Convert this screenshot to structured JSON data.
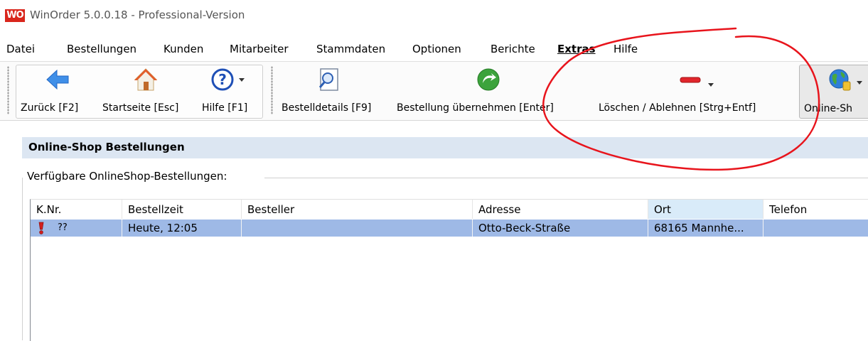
{
  "window": {
    "logo_text": "WO",
    "title": "WinOrder 5.0.0.18 - Professional-Version"
  },
  "menu": [
    "Datei",
    "Bestellungen",
    "Kunden",
    "Mitarbeiter",
    "Stammdaten",
    "Optionen",
    "Berichte",
    "Extras",
    "Hilfe"
  ],
  "toolbar": {
    "back": "Zurück [F2]",
    "home": "Startseite [Esc]",
    "help": "Hilfe [F1]",
    "details": "Bestelldetails [F9]",
    "accept": "Bestellung übernehmen [Enter]",
    "delete": "Löschen / Ablehnen [Strg+Entf]",
    "online_shop": "Online-Sh"
  },
  "section": {
    "title": "Online-Shop Bestellungen",
    "group_label": "Verfügbare OnlineShop-Bestellungen:"
  },
  "table": {
    "columns": [
      "K.Nr.",
      "Bestellzeit",
      "Besteller",
      "Adresse",
      "Ort",
      "Telefon"
    ],
    "rows": [
      {
        "knr": "??",
        "bestellzeit": "Heute, 12:05",
        "besteller": "",
        "adresse": "Otto-Beck-Straße",
        "ort": "68165 Mannhe...",
        "telefon": ""
      }
    ]
  },
  "colors": {
    "accent_header": "#dce6f2",
    "selected_row": "#9eb9e6",
    "annotation": "#e8141c"
  },
  "icons": [
    "app-logo",
    "back-arrow-icon",
    "home-icon",
    "help-icon",
    "details-icon",
    "accept-icon",
    "delete-icon",
    "globe-icon",
    "exclamation-icon"
  ]
}
